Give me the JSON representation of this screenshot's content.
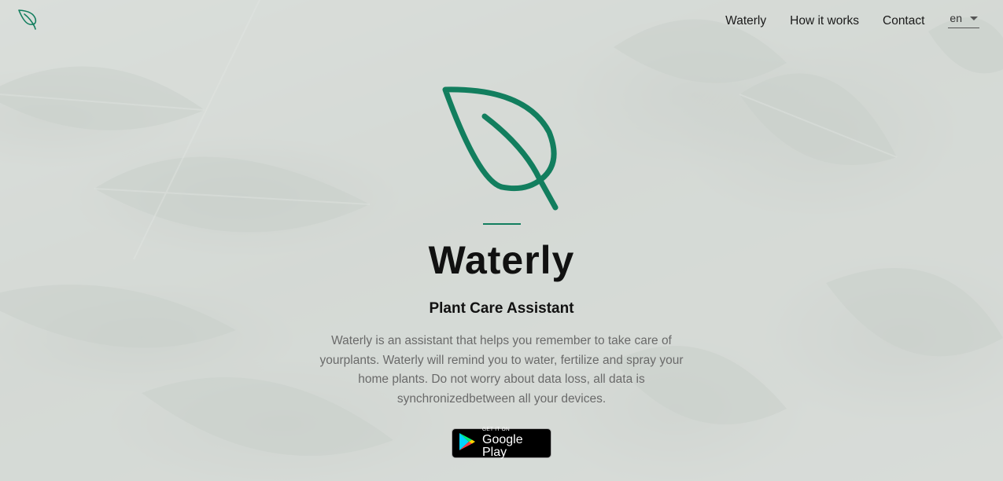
{
  "brand": {
    "accent_color": "#127e5e",
    "logo_icon": "leaf-icon"
  },
  "nav": {
    "items": [
      {
        "label": "Waterly"
      },
      {
        "label": "How it works"
      },
      {
        "label": "Contact"
      }
    ],
    "language": {
      "value": "en",
      "icon": "chevron-down-icon"
    }
  },
  "hero": {
    "icon": "leaf-icon",
    "title": "Waterly",
    "subtitle": "Plant Care Assistant",
    "description": "Waterly is an assistant that helps you remember to take care of yourplants. Waterly will remind you to water, fertilize and spray your home plants. Do not worry about data loss, all data is synchronizedbetween all your devices.",
    "store_badge": {
      "small_text": "GET IT ON",
      "big_text": "Google Play",
      "icon": "google-play-icon"
    }
  }
}
